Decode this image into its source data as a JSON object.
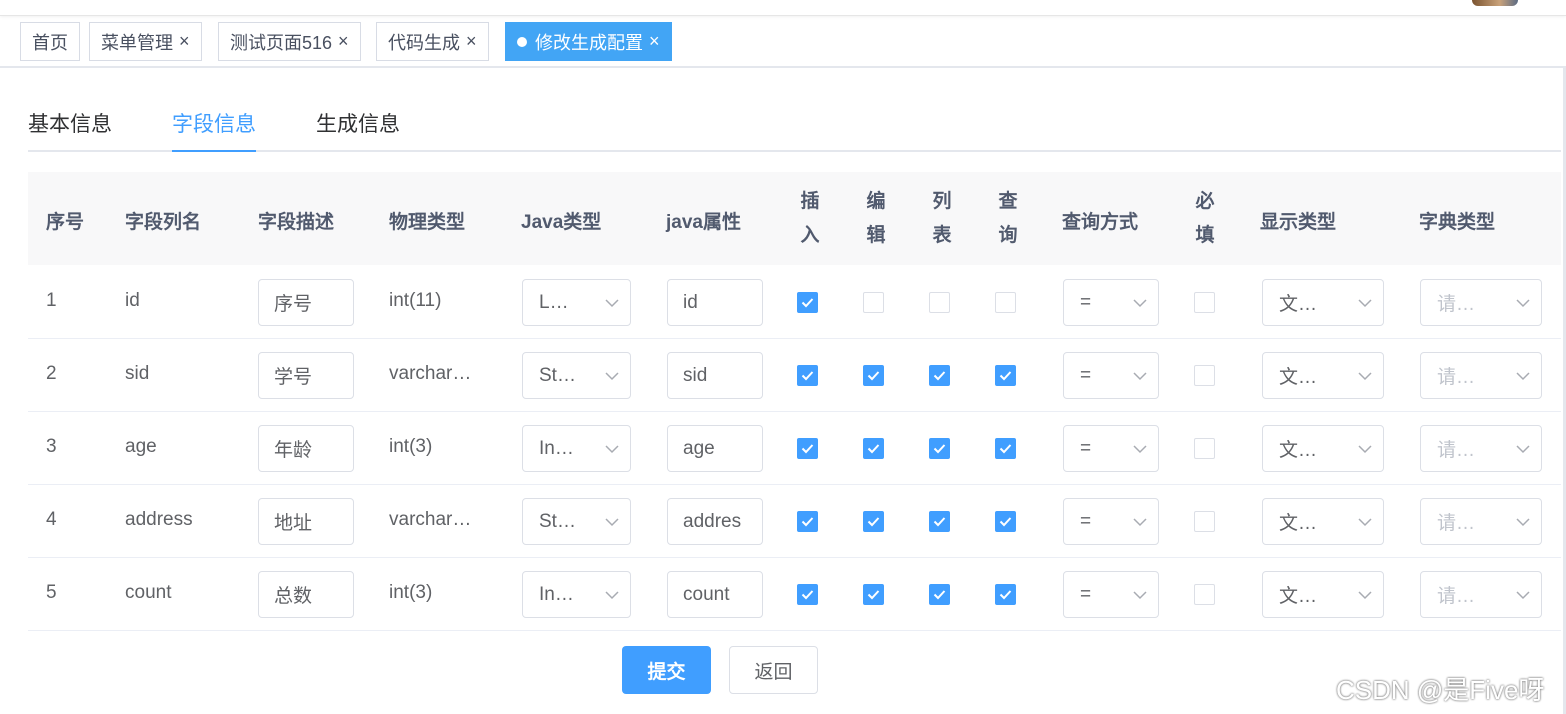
{
  "tags": [
    {
      "label": "首页",
      "closable": false,
      "active": false
    },
    {
      "label": "菜单管理",
      "closable": true,
      "active": false
    },
    {
      "label": "测试页面516",
      "closable": true,
      "active": false
    },
    {
      "label": "代码生成",
      "closable": true,
      "active": false
    },
    {
      "label": "修改生成配置",
      "closable": true,
      "active": true
    }
  ],
  "close_glyph": "×",
  "tabs": [
    "基本信息",
    "字段信息",
    "生成信息"
  ],
  "active_tab": "字段信息",
  "columns": {
    "index": "序号",
    "name": "字段列名",
    "desc": "字段描述",
    "phys": "物理类型",
    "javatype": "Java类型",
    "javaattr": "java属性",
    "insert": "插入",
    "edit": "编辑",
    "list": "列表",
    "query": "查询",
    "querytype": "查询方式",
    "required": "必填",
    "display": "显示类型",
    "dict": "字典类型"
  },
  "rows": [
    {
      "index": "1",
      "name": "id",
      "desc": "序号",
      "phys": "int(11)",
      "javatype": "L…",
      "javaattr": "id",
      "insert": true,
      "edit": false,
      "list": false,
      "query": false,
      "querytype": "=",
      "required": false,
      "display": "文…",
      "dict": "请…"
    },
    {
      "index": "2",
      "name": "sid",
      "desc": "学号",
      "phys": "varchar…",
      "javatype": "St…",
      "javaattr": "sid",
      "insert": true,
      "edit": true,
      "list": true,
      "query": true,
      "querytype": "=",
      "required": false,
      "display": "文…",
      "dict": "请…"
    },
    {
      "index": "3",
      "name": "age",
      "desc": "年龄",
      "phys": "int(3)",
      "javatype": "In…",
      "javaattr": "age",
      "insert": true,
      "edit": true,
      "list": true,
      "query": true,
      "querytype": "=",
      "required": false,
      "display": "文…",
      "dict": "请…"
    },
    {
      "index": "4",
      "name": "address",
      "desc": "地址",
      "phys": "varchar…",
      "javatype": "St…",
      "javaattr": "addres",
      "insert": true,
      "edit": true,
      "list": true,
      "query": true,
      "querytype": "=",
      "required": false,
      "display": "文…",
      "dict": "请…"
    },
    {
      "index": "5",
      "name": "count",
      "desc": "总数",
      "phys": "int(3)",
      "javatype": "In…",
      "javaattr": "count",
      "insert": true,
      "edit": true,
      "list": true,
      "query": true,
      "querytype": "=",
      "required": false,
      "display": "文…",
      "dict": "请…"
    }
  ],
  "buttons": {
    "submit": "提交",
    "back": "返回"
  },
  "watermark": "CSDN @是Five呀",
  "colors": {
    "primary": "#409eff",
    "tag_active": "#42a5f5",
    "header_bg": "#f8f8f9"
  }
}
